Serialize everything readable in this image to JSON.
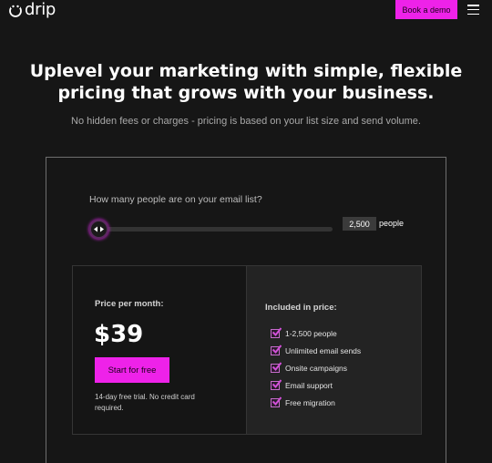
{
  "nav": {
    "logo_text": "drip",
    "book_demo_label": "Book a demo",
    "menu_icon": "hamburger-menu-icon"
  },
  "hero": {
    "headline_line1": "Uplevel your marketing with simple, flexible",
    "headline_line2": "pricing that grows with your business.",
    "subheadline": "No hidden fees or charges - pricing is based on your list size and send volume."
  },
  "calculator": {
    "question": "How many people are on your email list?",
    "slider_value_fraction": 0.0,
    "count_value": "2,500",
    "count_unit": "people",
    "price": {
      "label": "Price per month:",
      "amount": "$39",
      "cta_label": "Start for free",
      "trial_note": "14-day free trial. No credit card required."
    },
    "included": {
      "label": "Included in price:",
      "features": [
        "1-2,500 people",
        "Unlimited email sends",
        "Onsite campaigns",
        "Email support",
        "Free migration"
      ]
    }
  },
  "colors": {
    "background": "#161616",
    "accent": "#ee22e9",
    "checkbox_check": "#d24fd8"
  }
}
